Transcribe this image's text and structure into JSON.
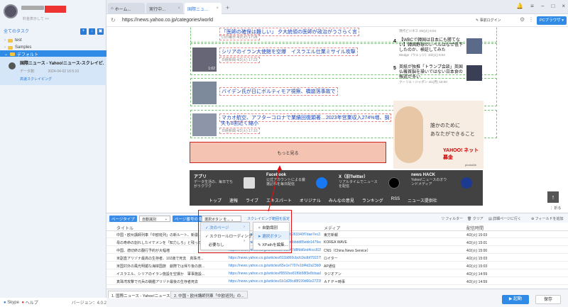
{
  "sidebar": {
    "subtitle": "料金表示して >>",
    "section_label": "全てのタスク",
    "tree": [
      "test",
      "Samples",
      "デフォルト"
    ],
    "task": {
      "title": "国際ニュース - Yahoo!ニュース-スクレイピ...",
      "meta_label": "データ数:",
      "meta_time": "2024-04-02 16:5:10",
      "status": "高速スクレイピング"
    },
    "footer_skype": "Skype",
    "footer_help": "ヘルプ",
    "version": "バージョン：4.0.2"
  },
  "tabs": [
    {
      "label": "ホーム..."
    },
    {
      "label": "実行中..."
    },
    {
      "label": "国際ニュ..."
    }
  ],
  "urlbar": {
    "url": "https://news.yahoo.co.jp/categories/world",
    "login": "事前ログイン",
    "browser_mode": "PCブラウザ ▾"
  },
  "news": [
    {
      "title": "「医師の確保は難しい」 夕大統領の医師が政治がうさらく言",
      "meta": "口の毎日 4/2(火) 17:28"
    },
    {
      "title": "シリアのイラン大使館を空爆　イスラエル仕業ミサイル攻撃",
      "meta": "日経新聞 4/2(火) 17:23",
      "duration": "1:02"
    },
    {
      "title": "バイデン氏が日にボルティモア視察、橋崩落事故で",
      "meta": "共同通信 4/2(火) 17:15"
    },
    {
      "title": "マカオ航空、アフターコロナで業績回復顕著…2023年営業収入274%増、損",
      "title2": "失も8割近く縮小",
      "meta": "日経新聞 4/2(火) 17:10"
    }
  ],
  "more_button": "もっと見る",
  "side_news": [
    {
      "num": "",
      "title": "現代ビジネス 4/2(火) 6:04",
      "meta": ""
    },
    {
      "num": "4",
      "title": "【WBCで韓国は日本にも勝てない】韓国野球のレベルはなぜ低下したのか、検証してみた",
      "meta": "Wedge（ウェッジ）4/2(火) 6:04"
    },
    {
      "num": "5",
      "title": "英紙が独推「トランプ会談」英国仏機首脳を操いではない日本食の報道が多い",
      "meta": "クーリエ・ジャポン 4/1(月) 18:00"
    }
  ],
  "ad": {
    "copy1": "誰かのために",
    "copy2": "あなたができること",
    "logo": "YAHOO! ネット募金",
    "credit": "photoAlb"
  },
  "footer_apps": [
    {
      "head": "アプリ",
      "desc": "データ生活の、毎日でちがうクワク"
    },
    {
      "head": "Facebook",
      "desc": "公式アカウントによる厳選記事を毎日配信"
    },
    {
      "head": "X（旧Twitter）",
      "desc": "リアルタイムでニュースを配信"
    },
    {
      "head": "news HACK",
      "desc": "Yahoo!ニュースのオウンドメディア"
    }
  ],
  "footer_links": [
    "トップ",
    "速報",
    "ライブ",
    "エキスパート",
    "オリジナル",
    "みんなの意見",
    "ランキング",
    "RSS",
    "ニュース提供社"
  ],
  "up_arrow": "↑",
  "collapse": "⋮ 折る",
  "toolbar": {
    "page_type": "ページタイプ",
    "auto_detect": "自動識別",
    "pager_label": "ページ番号の識別",
    "select_placeholder": "選択ボタン を...",
    "scroll_label": "スクレイピング範囲を設定",
    "filter": "▽ フィルター",
    "clear": "🗑 クリア",
    "detail": "▤ 詳細ページに行く",
    "add_field": "⊕ フィールドを追加"
  },
  "menu1": [
    "次のページ",
    "スクロールローディング",
    "必要なし"
  ],
  "menu2": [
    "自動識別",
    "選択ボタン",
    "XPathを編集..."
  ],
  "table": {
    "headers": [
      "タイトル",
      "",
      "メディア",
      "配信時間"
    ],
    "rows": [
      [
        "中国・欧州講師列車「中欧班列」の新ルート、新疆...",
        "https://news.yahoo.co.jp/articles/19a42b263340f7dae7ec2....",
        "東方新報",
        "4/2(火) 15:03"
      ],
      [
        "母の寿命の割れしたイケメンを「知力しろ」と残って...",
        "https://news.yahoo.co.jp/articles/a5c9fe0bbdd85ebb1479ea767f...",
        "KOREA WAVE",
        "4/2(火) 15:01"
      ],
      [
        "中国、適切終の翻行予約が大幅増",
        "https://news.yahoo.co.jp/articles/3720d47d8fdd6ed4ccc8157cf5d1...",
        "CNS（China News Service）",
        "4/2(火) 15:00"
      ],
      [
        "米副直アリゾナ最高の生存者、102歳で死去　真珠湾...",
        "https://news.yahoo.co.jp/articles/611b860cbcfc9cdbf7922753334e2137...",
        "ロイター",
        "4/2(火) 15:03"
      ],
      [
        "米国対外の風光明媚な海岸国旅　劇際では帰り後の旅...",
        "https://news.yahoo.co.jp/articles/65e1e7707e1bf4d2a23b0066d9fb...",
        "AP通信",
        "4/2(火) 15:03"
      ],
      [
        "イスラエル、シリアのイラン施設を空爆か　軍事施設...",
        "https://news.yahoo.co.jp/articles/f9550ce81f6b58f3e8cbaa9938637...",
        "ラジオアン",
        "4/2(火) 14:59"
      ],
      [
        "真珠湾攻撃で元兵の戦艦アリゾナ最後の生存者死去",
        "https://news.yahoo.co.jp/articles/1b1d28cd8f199d66e27235f6b99e2...",
        "ＡＦＰ＝時事",
        "4/2(火) 14:59"
      ]
    ]
  },
  "bottom_tabs": [
    "1. 国際ニュース - Yahoo!ニュース",
    "2. 中国・欧州講師列車「中欧班列」の..."
  ],
  "buttons": {
    "run": "▶ 起動",
    "save": "保存"
  }
}
